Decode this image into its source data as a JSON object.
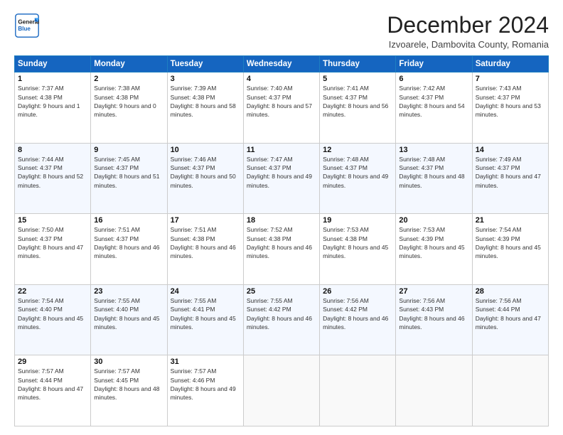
{
  "header": {
    "logo_line1": "General",
    "logo_line2": "Blue",
    "title": "December 2024",
    "subtitle": "Izvoarele, Dambovita County, Romania"
  },
  "calendar": {
    "days_of_week": [
      "Sunday",
      "Monday",
      "Tuesday",
      "Wednesday",
      "Thursday",
      "Friday",
      "Saturday"
    ],
    "weeks": [
      [
        null,
        null,
        null,
        null,
        null,
        null,
        null
      ]
    ],
    "cells": [
      {
        "day": 1,
        "col": 0,
        "sunrise": "7:37 AM",
        "sunset": "4:38 PM",
        "daylight": "9 hours and 1 minute."
      },
      {
        "day": 2,
        "col": 1,
        "sunrise": "7:38 AM",
        "sunset": "4:38 PM",
        "daylight": "9 hours and 0 minutes."
      },
      {
        "day": 3,
        "col": 2,
        "sunrise": "7:39 AM",
        "sunset": "4:38 PM",
        "daylight": "8 hours and 58 minutes."
      },
      {
        "day": 4,
        "col": 3,
        "sunrise": "7:40 AM",
        "sunset": "4:37 PM",
        "daylight": "8 hours and 57 minutes."
      },
      {
        "day": 5,
        "col": 4,
        "sunrise": "7:41 AM",
        "sunset": "4:37 PM",
        "daylight": "8 hours and 56 minutes."
      },
      {
        "day": 6,
        "col": 5,
        "sunrise": "7:42 AM",
        "sunset": "4:37 PM",
        "daylight": "8 hours and 54 minutes."
      },
      {
        "day": 7,
        "col": 6,
        "sunrise": "7:43 AM",
        "sunset": "4:37 PM",
        "daylight": "8 hours and 53 minutes."
      },
      {
        "day": 8,
        "col": 0,
        "sunrise": "7:44 AM",
        "sunset": "4:37 PM",
        "daylight": "8 hours and 52 minutes."
      },
      {
        "day": 9,
        "col": 1,
        "sunrise": "7:45 AM",
        "sunset": "4:37 PM",
        "daylight": "8 hours and 51 minutes."
      },
      {
        "day": 10,
        "col": 2,
        "sunrise": "7:46 AM",
        "sunset": "4:37 PM",
        "daylight": "8 hours and 50 minutes."
      },
      {
        "day": 11,
        "col": 3,
        "sunrise": "7:47 AM",
        "sunset": "4:37 PM",
        "daylight": "8 hours and 49 minutes."
      },
      {
        "day": 12,
        "col": 4,
        "sunrise": "7:48 AM",
        "sunset": "4:37 PM",
        "daylight": "8 hours and 49 minutes."
      },
      {
        "day": 13,
        "col": 5,
        "sunrise": "7:48 AM",
        "sunset": "4:37 PM",
        "daylight": "8 hours and 48 minutes."
      },
      {
        "day": 14,
        "col": 6,
        "sunrise": "7:49 AM",
        "sunset": "4:37 PM",
        "daylight": "8 hours and 47 minutes."
      },
      {
        "day": 15,
        "col": 0,
        "sunrise": "7:50 AM",
        "sunset": "4:37 PM",
        "daylight": "8 hours and 47 minutes."
      },
      {
        "day": 16,
        "col": 1,
        "sunrise": "7:51 AM",
        "sunset": "4:37 PM",
        "daylight": "8 hours and 46 minutes."
      },
      {
        "day": 17,
        "col": 2,
        "sunrise": "7:51 AM",
        "sunset": "4:38 PM",
        "daylight": "8 hours and 46 minutes."
      },
      {
        "day": 18,
        "col": 3,
        "sunrise": "7:52 AM",
        "sunset": "4:38 PM",
        "daylight": "8 hours and 46 minutes."
      },
      {
        "day": 19,
        "col": 4,
        "sunrise": "7:53 AM",
        "sunset": "4:38 PM",
        "daylight": "8 hours and 45 minutes."
      },
      {
        "day": 20,
        "col": 5,
        "sunrise": "7:53 AM",
        "sunset": "4:39 PM",
        "daylight": "8 hours and 45 minutes."
      },
      {
        "day": 21,
        "col": 6,
        "sunrise": "7:54 AM",
        "sunset": "4:39 PM",
        "daylight": "8 hours and 45 minutes."
      },
      {
        "day": 22,
        "col": 0,
        "sunrise": "7:54 AM",
        "sunset": "4:40 PM",
        "daylight": "8 hours and 45 minutes."
      },
      {
        "day": 23,
        "col": 1,
        "sunrise": "7:55 AM",
        "sunset": "4:40 PM",
        "daylight": "8 hours and 45 minutes."
      },
      {
        "day": 24,
        "col": 2,
        "sunrise": "7:55 AM",
        "sunset": "4:41 PM",
        "daylight": "8 hours and 45 minutes."
      },
      {
        "day": 25,
        "col": 3,
        "sunrise": "7:55 AM",
        "sunset": "4:42 PM",
        "daylight": "8 hours and 46 minutes."
      },
      {
        "day": 26,
        "col": 4,
        "sunrise": "7:56 AM",
        "sunset": "4:42 PM",
        "daylight": "8 hours and 46 minutes."
      },
      {
        "day": 27,
        "col": 5,
        "sunrise": "7:56 AM",
        "sunset": "4:43 PM",
        "daylight": "8 hours and 46 minutes."
      },
      {
        "day": 28,
        "col": 6,
        "sunrise": "7:56 AM",
        "sunset": "4:44 PM",
        "daylight": "8 hours and 47 minutes."
      },
      {
        "day": 29,
        "col": 0,
        "sunrise": "7:57 AM",
        "sunset": "4:44 PM",
        "daylight": "8 hours and 47 minutes."
      },
      {
        "day": 30,
        "col": 1,
        "sunrise": "7:57 AM",
        "sunset": "4:45 PM",
        "daylight": "8 hours and 48 minutes."
      },
      {
        "day": 31,
        "col": 2,
        "sunrise": "7:57 AM",
        "sunset": "4:46 PM",
        "daylight": "8 hours and 49 minutes."
      }
    ],
    "labels": {
      "sunrise": "Sunrise:",
      "sunset": "Sunset:",
      "daylight": "Daylight:"
    }
  }
}
